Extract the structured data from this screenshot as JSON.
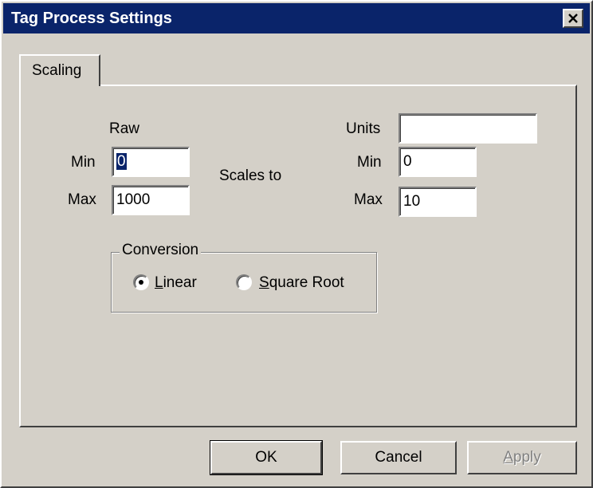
{
  "window": {
    "title": "Tag Process Settings",
    "close_glyph": "✕"
  },
  "tabs": [
    {
      "label": "Scaling",
      "active": true
    }
  ],
  "raw": {
    "header": "Raw",
    "min_label": "Min",
    "min_value": "0",
    "max_label": "Max",
    "max_value": "1000"
  },
  "scales_to_label": "Scales to",
  "units": {
    "label": "Units",
    "value": "",
    "min_label": "Min",
    "min_value": "0",
    "max_label": "Max",
    "max_value": "10"
  },
  "conversion": {
    "title": "Conversion",
    "options": [
      {
        "label": "Linear",
        "mnemonic": "L",
        "rest": "inear",
        "selected": true
      },
      {
        "label": "Square Root",
        "mnemonic": "S",
        "rest": "quare Root",
        "selected": false
      }
    ]
  },
  "buttons": {
    "ok": "OK",
    "cancel": "Cancel",
    "apply": "Apply",
    "apply_mnemonic": "A",
    "apply_rest": "pply",
    "apply_enabled": false
  },
  "colors": {
    "titlebar": "#0a246a",
    "face": "#d4d0c8",
    "selection": "#0a246a"
  }
}
